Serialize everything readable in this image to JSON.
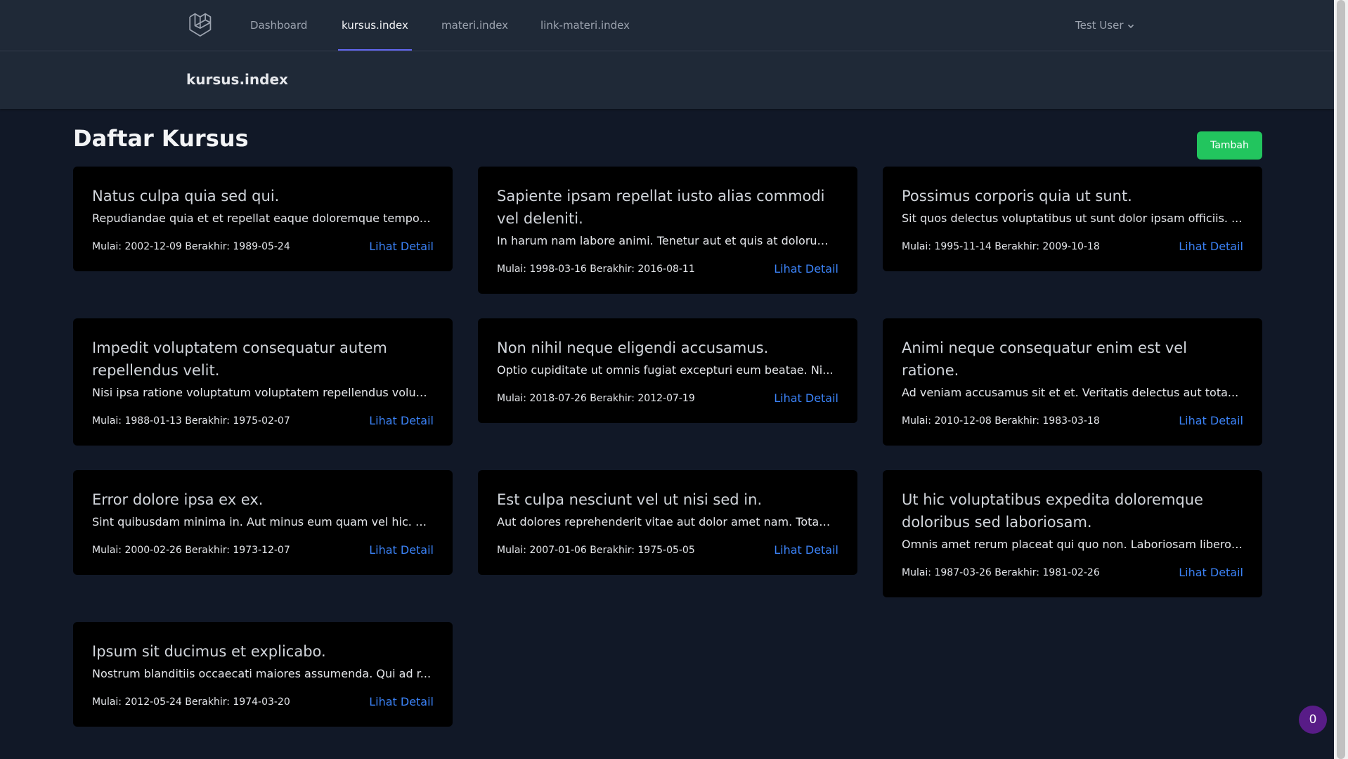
{
  "nav": {
    "links": [
      {
        "label": "Dashboard"
      },
      {
        "label": "kursus.index"
      },
      {
        "label": "materi.index"
      },
      {
        "label": "link-materi.index"
      }
    ],
    "user": "Test User"
  },
  "header": {
    "title": "kursus.index"
  },
  "main": {
    "title": "Daftar Kursus",
    "add_label": "Tambah",
    "cards": [
      {
        "title": "Natus culpa quia sed qui.",
        "desc": "Repudiandae quia et et repellat eaque doloremque tempor...",
        "dates": "Mulai: 2002-12-09 Berakhir: 1989-05-24",
        "link": "Lihat Detail"
      },
      {
        "title": "Sapiente ipsam repellat iusto alias commodi vel deleniti.",
        "desc": "In harum nam labore animi. Tenetur aut et quis at dolorum ...",
        "dates": "Mulai: 1998-03-16 Berakhir: 2016-08-11",
        "link": "Lihat Detail"
      },
      {
        "title": "Possimus corporis quia ut sunt.",
        "desc": "Sit quos delectus voluptatibus ut sunt dolor ipsam officiis. ...",
        "dates": "Mulai: 1995-11-14 Berakhir: 2009-10-18",
        "link": "Lihat Detail"
      },
      {
        "title": "Impedit voluptatem consequatur autem repellendus velit.",
        "desc": "Nisi ipsa ratione voluptatum voluptatem repellendus volup...",
        "dates": "Mulai: 1988-01-13 Berakhir: 1975-02-07",
        "link": "Lihat Detail"
      },
      {
        "title": "Non nihil neque eligendi accusamus.",
        "desc": "Optio cupiditate ut omnis fugiat excepturi eum beatae. Ni...",
        "dates": "Mulai: 2018-07-26 Berakhir: 2012-07-19",
        "link": "Lihat Detail"
      },
      {
        "title": "Animi neque consequatur enim est vel ratione.",
        "desc": "Ad veniam accusamus sit et et. Veritatis delectus aut tota...",
        "dates": "Mulai: 2010-12-08 Berakhir: 1983-03-18",
        "link": "Lihat Detail"
      },
      {
        "title": "Error dolore ipsa ex ex.",
        "desc": "Sint quibusdam minima in. Aut minus eum quam vel hic. Et...",
        "dates": "Mulai: 2000-02-26 Berakhir: 1973-12-07",
        "link": "Lihat Detail"
      },
      {
        "title": "Est culpa nesciunt vel ut nisi sed in.",
        "desc": "Aut dolores reprehenderit vitae aut dolor amet nam. Totam...",
        "dates": "Mulai: 2007-01-06 Berakhir: 1975-05-05",
        "link": "Lihat Detail"
      },
      {
        "title": "Ut hic voluptatibus expedita doloremque doloribus sed laboriosam.",
        "desc": "Omnis amet rerum placeat qui quo non. Laboriosam libero ...",
        "dates": "Mulai: 1987-03-26 Berakhir: 1981-02-26",
        "link": "Lihat Detail"
      },
      {
        "title": "Ipsum sit ducimus et explicabo.",
        "desc": "Nostrum blanditiis occaecati maiores assumenda. Qui ad r...",
        "dates": "Mulai: 2012-05-24 Berakhir: 1974-03-20",
        "link": "Lihat Detail"
      }
    ]
  },
  "badge": {
    "count": "0"
  },
  "colors": {
    "accent": "#6366f1",
    "add_button": "#22c55e",
    "link": "#3b82f6",
    "badge": "#581c87"
  }
}
